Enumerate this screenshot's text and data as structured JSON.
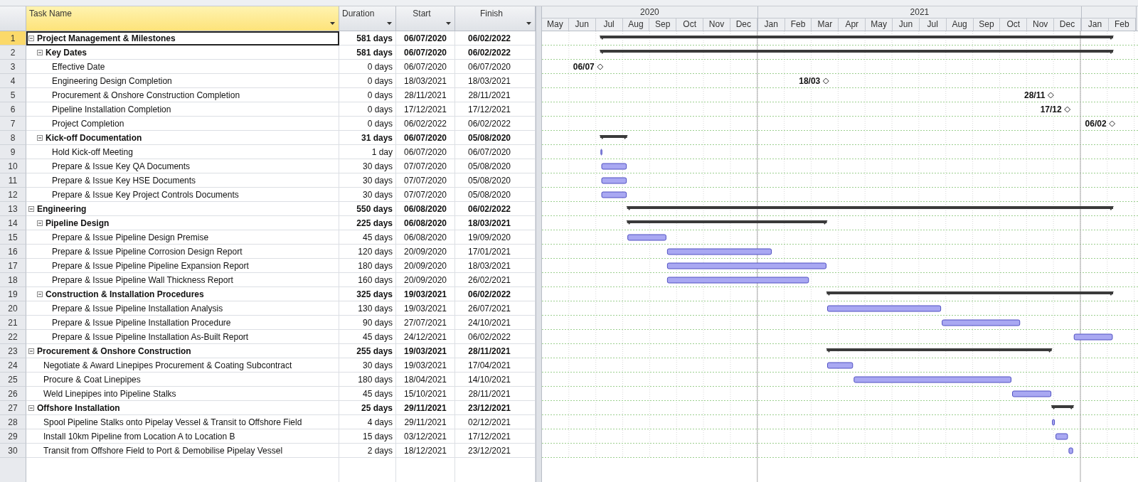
{
  "columns": [
    {
      "label": "Task Name",
      "selected": true
    },
    {
      "label": "Duration",
      "selected": false
    },
    {
      "label": "Start",
      "selected": false
    },
    {
      "label": "Finish",
      "selected": false
    }
  ],
  "timescale": [
    {
      "label": "2020",
      "months": [
        "May",
        "Jun",
        "Jul",
        "Aug",
        "Sep",
        "Oct",
        "Nov",
        "Dec"
      ]
    },
    {
      "label": "2021",
      "months": [
        "Jan",
        "Feb",
        "Mar",
        "Apr",
        "May",
        "Jun",
        "Jul",
        "Aug",
        "Sep",
        "Oct",
        "Nov",
        "Dec"
      ]
    },
    {
      "months": [
        "Jan",
        "Feb"
      ]
    }
  ],
  "tasks": [
    {
      "id": "1",
      "name": "Project Management & Milestones",
      "duration": "581 days",
      "start": "06/07/2020",
      "finish": "06/02/2022",
      "kind": "summary",
      "expanded": true,
      "selected": true,
      "children": [
        {
          "id": "2",
          "name": "Key Dates",
          "duration": "581 days",
          "start": "06/07/2020",
          "finish": "06/02/2022",
          "kind": "summary",
          "expanded": true,
          "selected": false,
          "children": [
            {
              "id": "3",
              "name": "Effective Date",
              "duration": "0 days",
              "start": "06/07/2020",
              "finish": "06/07/2020",
              "kind": "milestone",
              "milestone_label": "06/07",
              "selected": false
            },
            {
              "id": "4",
              "name": "Engineering Design Completion",
              "duration": "0 days",
              "start": "18/03/2021",
              "finish": "18/03/2021",
              "kind": "milestone",
              "milestone_label": "18/03",
              "selected": false
            },
            {
              "id": "5",
              "name": "Procurement & Onshore Construction Completion",
              "duration": "0 days",
              "start": "28/11/2021",
              "finish": "28/11/2021",
              "kind": "milestone",
              "milestone_label": "28/11",
              "selected": false
            },
            {
              "id": "6",
              "name": "Pipeline Installation Completion",
              "duration": "0 days",
              "start": "17/12/2021",
              "finish": "17/12/2021",
              "kind": "milestone",
              "milestone_label": "17/12",
              "selected": false
            },
            {
              "id": "7",
              "name": "Project Completion",
              "duration": "0 days",
              "start": "06/02/2022",
              "finish": "06/02/2022",
              "kind": "milestone",
              "milestone_label": "06/02",
              "selected": false
            }
          ]
        },
        {
          "id": "8",
          "name": "Kick-off Documentation",
          "duration": "31 days",
          "start": "06/07/2020",
          "finish": "05/08/2020",
          "kind": "summary",
          "expanded": true,
          "selected": false,
          "children": [
            {
              "id": "9",
              "name": "Hold Kick-off Meeting",
              "duration": "1 day",
              "start": "06/07/2020",
              "finish": "06/07/2020",
              "kind": "task",
              "selected": false
            },
            {
              "id": "10",
              "name": "Prepare & Issue Key QA Documents",
              "duration": "30 days",
              "start": "07/07/2020",
              "finish": "05/08/2020",
              "kind": "task",
              "selected": false
            },
            {
              "id": "11",
              "name": "Prepare & Issue Key HSE Documents",
              "duration": "30 days",
              "start": "07/07/2020",
              "finish": "05/08/2020",
              "kind": "task",
              "selected": false
            },
            {
              "id": "12",
              "name": "Prepare & Issue Key Project Controls Documents",
              "duration": "30 days",
              "start": "07/07/2020",
              "finish": "05/08/2020",
              "kind": "task",
              "selected": false
            }
          ]
        }
      ]
    },
    {
      "id": "13",
      "name": "Engineering",
      "duration": "550 days",
      "start": "06/08/2020",
      "finish": "06/02/2022",
      "kind": "summary",
      "expanded": true,
      "selected": false,
      "children": [
        {
          "id": "14",
          "name": "Pipeline Design",
          "duration": "225 days",
          "start": "06/08/2020",
          "finish": "18/03/2021",
          "kind": "summary",
          "expanded": true,
          "selected": false,
          "children": [
            {
              "id": "15",
              "name": "Prepare & Issue Pipeline Design Premise",
              "duration": "45 days",
              "start": "06/08/2020",
              "finish": "19/09/2020",
              "kind": "task",
              "selected": false
            },
            {
              "id": "16",
              "name": "Prepare & Issue Pipeline Corrosion Design Report",
              "duration": "120 days",
              "start": "20/09/2020",
              "finish": "17/01/2021",
              "kind": "task",
              "selected": false
            },
            {
              "id": "17",
              "name": "Prepare & Issue Pipeline Pipeline Expansion Report",
              "duration": "180 days",
              "start": "20/09/2020",
              "finish": "18/03/2021",
              "kind": "task",
              "selected": false
            },
            {
              "id": "18",
              "name": "Prepare & Issue Pipeline Wall Thickness Report",
              "duration": "160 days",
              "start": "20/09/2020",
              "finish": "26/02/2021",
              "kind": "task",
              "selected": false
            }
          ]
        },
        {
          "id": "19",
          "name": "Construction & Installation Procedures",
          "duration": "325 days",
          "start": "19/03/2021",
          "finish": "06/02/2022",
          "kind": "summary",
          "expanded": true,
          "selected": false,
          "children": [
            {
              "id": "20",
              "name": "Prepare & Issue Pipeline Installation Analysis",
              "duration": "130 days",
              "start": "19/03/2021",
              "finish": "26/07/2021",
              "kind": "task",
              "selected": false
            },
            {
              "id": "21",
              "name": "Prepare & Issue Pipeline Installation Procedure",
              "duration": "90 days",
              "start": "27/07/2021",
              "finish": "24/10/2021",
              "kind": "task",
              "selected": false
            },
            {
              "id": "22",
              "name": "Prepare & Issue Pipeline Installation As-Built Report",
              "duration": "45 days",
              "start": "24/12/2021",
              "finish": "06/02/2022",
              "kind": "task",
              "selected": false
            }
          ]
        }
      ]
    },
    {
      "id": "23",
      "name": "Procurement & Onshore Construction",
      "duration": "255 days",
      "start": "19/03/2021",
      "finish": "28/11/2021",
      "kind": "summary",
      "expanded": true,
      "selected": false,
      "children": [
        {
          "id": "24",
          "name": "Negotiate & Award Linepipes Procurement & Coating Subcontract",
          "duration": "30 days",
          "start": "19/03/2021",
          "finish": "17/04/2021",
          "kind": "task",
          "selected": false
        },
        {
          "id": "25",
          "name": "Procure & Coat Linepipes",
          "duration": "180 days",
          "start": "18/04/2021",
          "finish": "14/10/2021",
          "kind": "task",
          "selected": false
        },
        {
          "id": "26",
          "name": "Weld Linepipes into Pipeline Stalks",
          "duration": "45 days",
          "start": "15/10/2021",
          "finish": "28/11/2021",
          "kind": "task",
          "selected": false
        }
      ]
    },
    {
      "id": "27",
      "name": "Offshore Installation",
      "duration": "25 days",
      "start": "29/11/2021",
      "finish": "23/12/2021",
      "kind": "summary",
      "expanded": true,
      "selected": false,
      "children": [
        {
          "id": "28",
          "name": "Spool Pipeline Stalks onto Pipelay Vessel & Transit to Offshore Field",
          "duration": "4 days",
          "start": "29/11/2021",
          "finish": "02/12/2021",
          "kind": "task",
          "selected": false
        },
        {
          "id": "29",
          "name": "Install 10km Pipeline from Location A to Location B",
          "duration": "15 days",
          "start": "03/12/2021",
          "finish": "17/12/2021",
          "kind": "task",
          "selected": false
        },
        {
          "id": "30",
          "name": "Transit from Offshore Field to Port & Demobilise Pipelay Vessel",
          "duration": "2 days",
          "start": "18/12/2021",
          "finish": "23/12/2021",
          "kind": "task",
          "selected": false
        }
      ]
    }
  ]
}
